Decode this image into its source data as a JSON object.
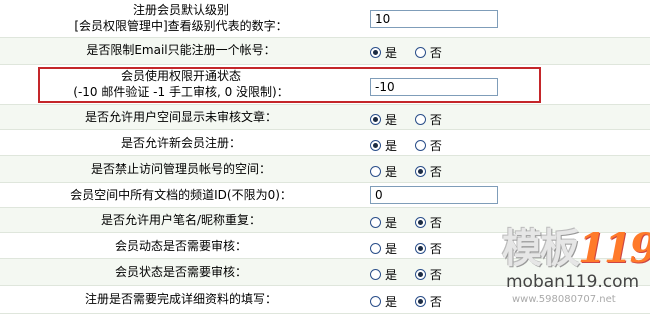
{
  "radio_labels": {
    "yes": "是",
    "no": "否"
  },
  "rows": [
    {
      "label1": "注册会员默认级别",
      "label2": "[会员权限管理中]查看级别代表的数字：",
      "type": "text",
      "value": "10"
    },
    {
      "label1": "是否限制Email只能注册一个帐号：",
      "type": "radio",
      "selected": "yes"
    },
    {
      "label1": "会员使用权限开通状态",
      "label2": "(-10 邮件验证 -1 手工审核, 0 没限制)：",
      "type": "text",
      "value": "-10"
    },
    {
      "label1": "是否允许用户空间显示未审核文章：",
      "type": "radio",
      "selected": "yes"
    },
    {
      "label1": "是否允许新会员注册：",
      "type": "radio",
      "selected": "yes"
    },
    {
      "label1": "是否禁止访问管理员帐号的空间：",
      "type": "radio",
      "selected": "no"
    },
    {
      "label1": "会员空间中所有文档的频道ID(不限为0)：",
      "type": "text",
      "value": "0"
    },
    {
      "label1": "是否允许用户笔名/昵称重复：",
      "type": "radio",
      "selected": "no"
    },
    {
      "label1": "会员动态是否需要审核：",
      "type": "radio",
      "selected": "no"
    },
    {
      "label1": "会员状态是否需要审核：",
      "type": "radio",
      "selected": "no"
    },
    {
      "label1": "注册是否需要完成详细资料的填写：",
      "type": "radio",
      "selected": "no"
    }
  ],
  "watermark": {
    "logo_cn": "模板",
    "logo_num": "119",
    "url": "moban119.com",
    "sub": "www.598080707.net"
  },
  "colors": {
    "highlight": "#c4262a",
    "alt_row": "#f4f8f2"
  }
}
